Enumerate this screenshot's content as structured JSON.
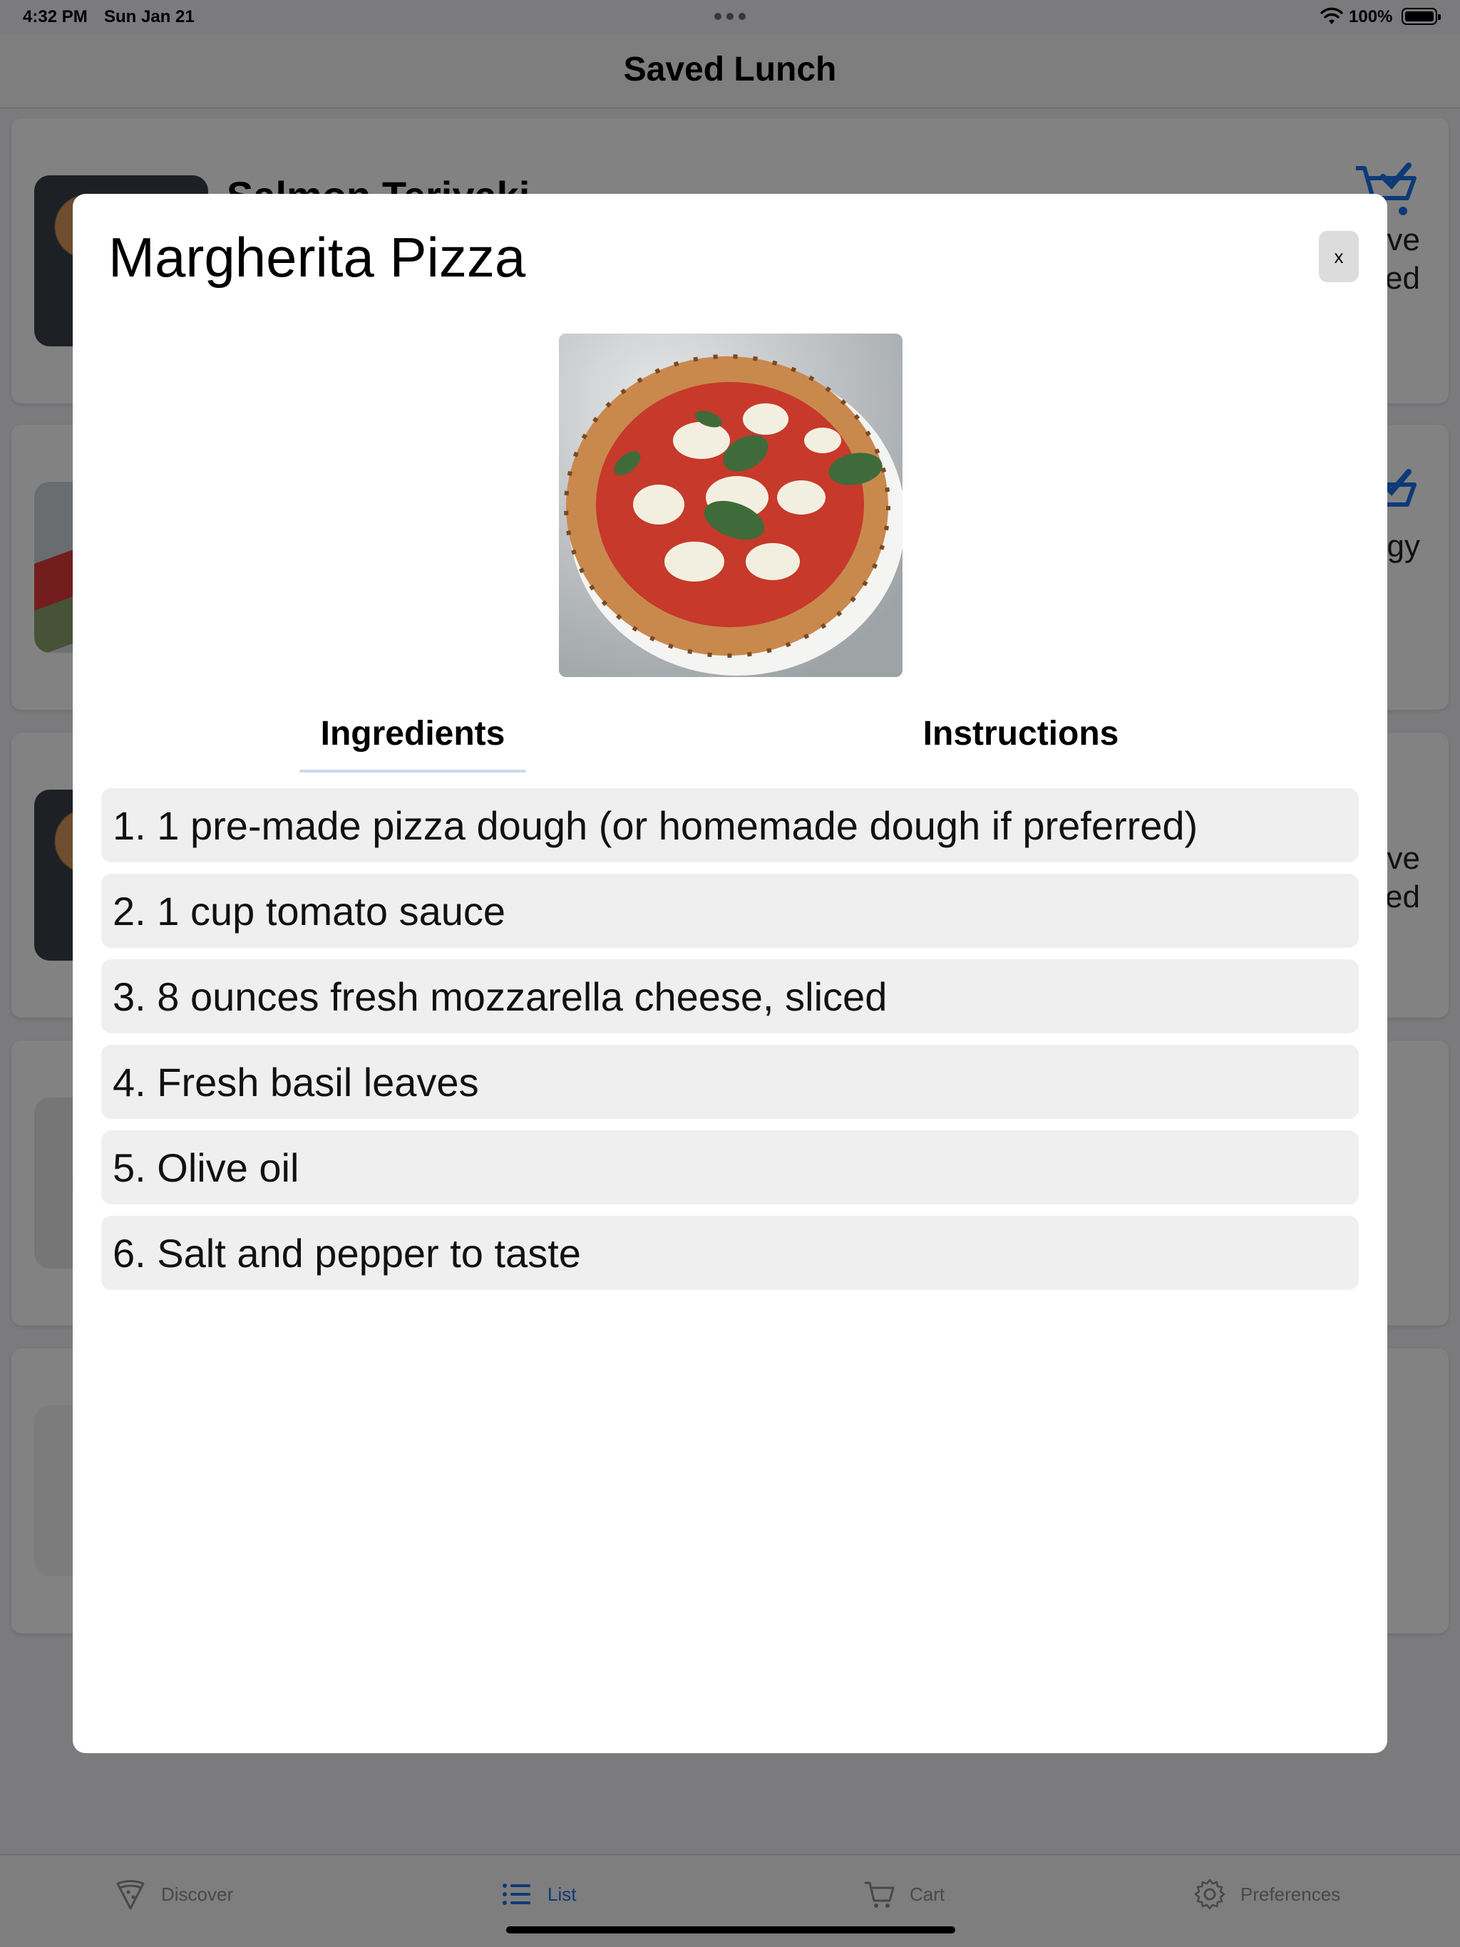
{
  "status_bar": {
    "time": "4:32 PM",
    "date": "Sun Jan 21",
    "battery_percent": "100%"
  },
  "nav": {
    "title": "Saved Lunch"
  },
  "background_cards": [
    {
      "title": "Salmon Teriyaki",
      "action_label_top": "ve",
      "action_label_bottom": "ed"
    },
    {
      "title": "",
      "action_label_top": "gy",
      "action_label_bottom": ""
    },
    {
      "title": "",
      "action_label_top": "ve",
      "action_label_bottom": "ed"
    },
    {
      "title": "",
      "action_label_top": "",
      "action_label_bottom": ""
    },
    {
      "title": "",
      "action_label_top": "",
      "action_label_bottom": ""
    }
  ],
  "modal": {
    "title": "Margherita Pizza",
    "close_label": "x",
    "tabs": [
      {
        "label": "Ingredients",
        "selected": true
      },
      {
        "label": "Instructions",
        "selected": false
      }
    ],
    "ingredients": [
      "1. 1 pre-made pizza dough (or homemade dough if preferred)",
      "2. 1 cup tomato sauce",
      "3. 8 ounces fresh mozzarella cheese, sliced",
      "4. Fresh basil leaves",
      "5. Olive oil",
      "6. Salt and pepper to taste"
    ]
  },
  "tab_bar": {
    "items": [
      {
        "label": "Discover",
        "icon": "pizza-slice-icon",
        "active": false
      },
      {
        "label": "List",
        "icon": "list-icon",
        "active": true
      },
      {
        "label": "Cart",
        "icon": "cart-icon",
        "active": false
      },
      {
        "label": "Preferences",
        "icon": "gear-icon",
        "active": false
      }
    ]
  },
  "colors": {
    "accent": "#1a73e8",
    "cart_icon": "#1a73e8",
    "scrim": "rgba(0,0,0,0.49)"
  }
}
